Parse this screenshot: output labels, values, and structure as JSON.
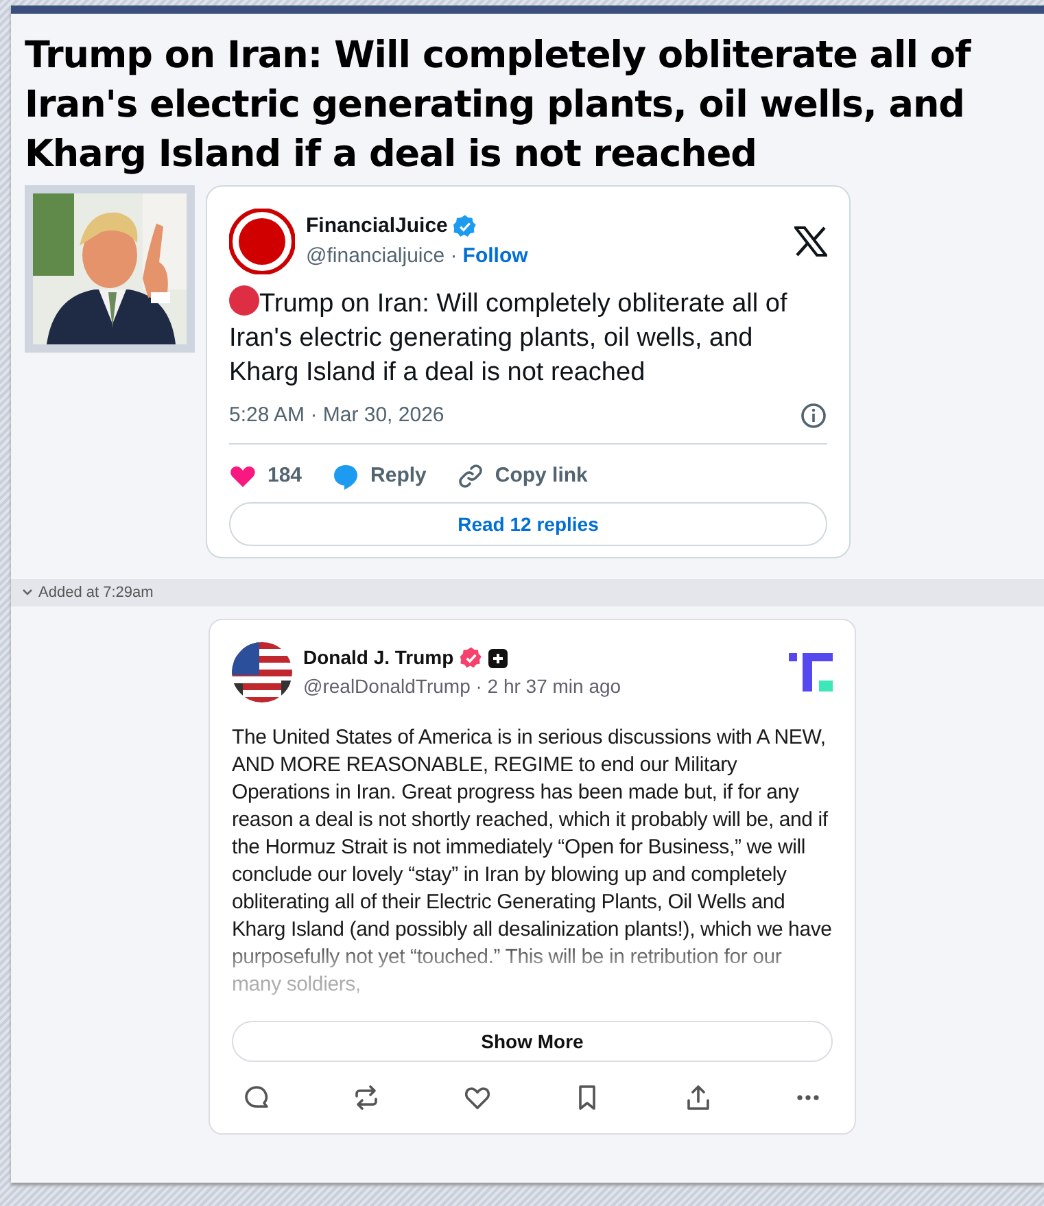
{
  "headline": "Trump on Iran: Will completely obliterate all of Iran's electric generating plants, oil wells, and Kharg Island if a deal is not reached",
  "embedded_tweet": {
    "name": "FinancialJuice",
    "verified": true,
    "handle": "@financialjuice ·",
    "follow": "Follow",
    "text": "Trump on Iran: Will completely obliterate all of Iran's electric generating plants, oil wells, and Kharg Island if a deal is not reached",
    "timestamp": "5:28 AM · Mar 30, 2026",
    "actions": [
      {
        "kind": "like",
        "label": "184"
      },
      {
        "kind": "reply",
        "label": "Reply"
      },
      {
        "kind": "copy",
        "label": "Copy link"
      }
    ],
    "read_replies": "Read 12 replies"
  },
  "divider": {
    "label": "Added at 7:29am",
    "expanded": true
  },
  "truth_post": {
    "name": "Donald J. Trump",
    "verified": true,
    "meta": "@realDonaldTrump · 2 hr 37 min ago",
    "text": "The United States of America is in serious discussions with A NEW, AND MORE REASONABLE, REGIME to end our Military Operations in Iran. Great progress has been made but, if for any reason a deal is not shortly reached, which it probably will be, and if the Hormuz Strait is not immediately “Open for Business,” we will conclude our lovely “stay” in Iran by blowing up and completely obliterating all of their Electric Generating Plants, Oil Wells and Kharg Island (and possibly all desalinization plants!), which we have purposefully not yet “touched.” This will be in retribution for our many soldiers,",
    "show_more": "Show More",
    "actions": [
      {
        "kind": "comment"
      },
      {
        "kind": "repost"
      },
      {
        "kind": "like"
      },
      {
        "kind": "bookmark"
      },
      {
        "kind": "share"
      },
      {
        "kind": "more"
      }
    ]
  }
}
